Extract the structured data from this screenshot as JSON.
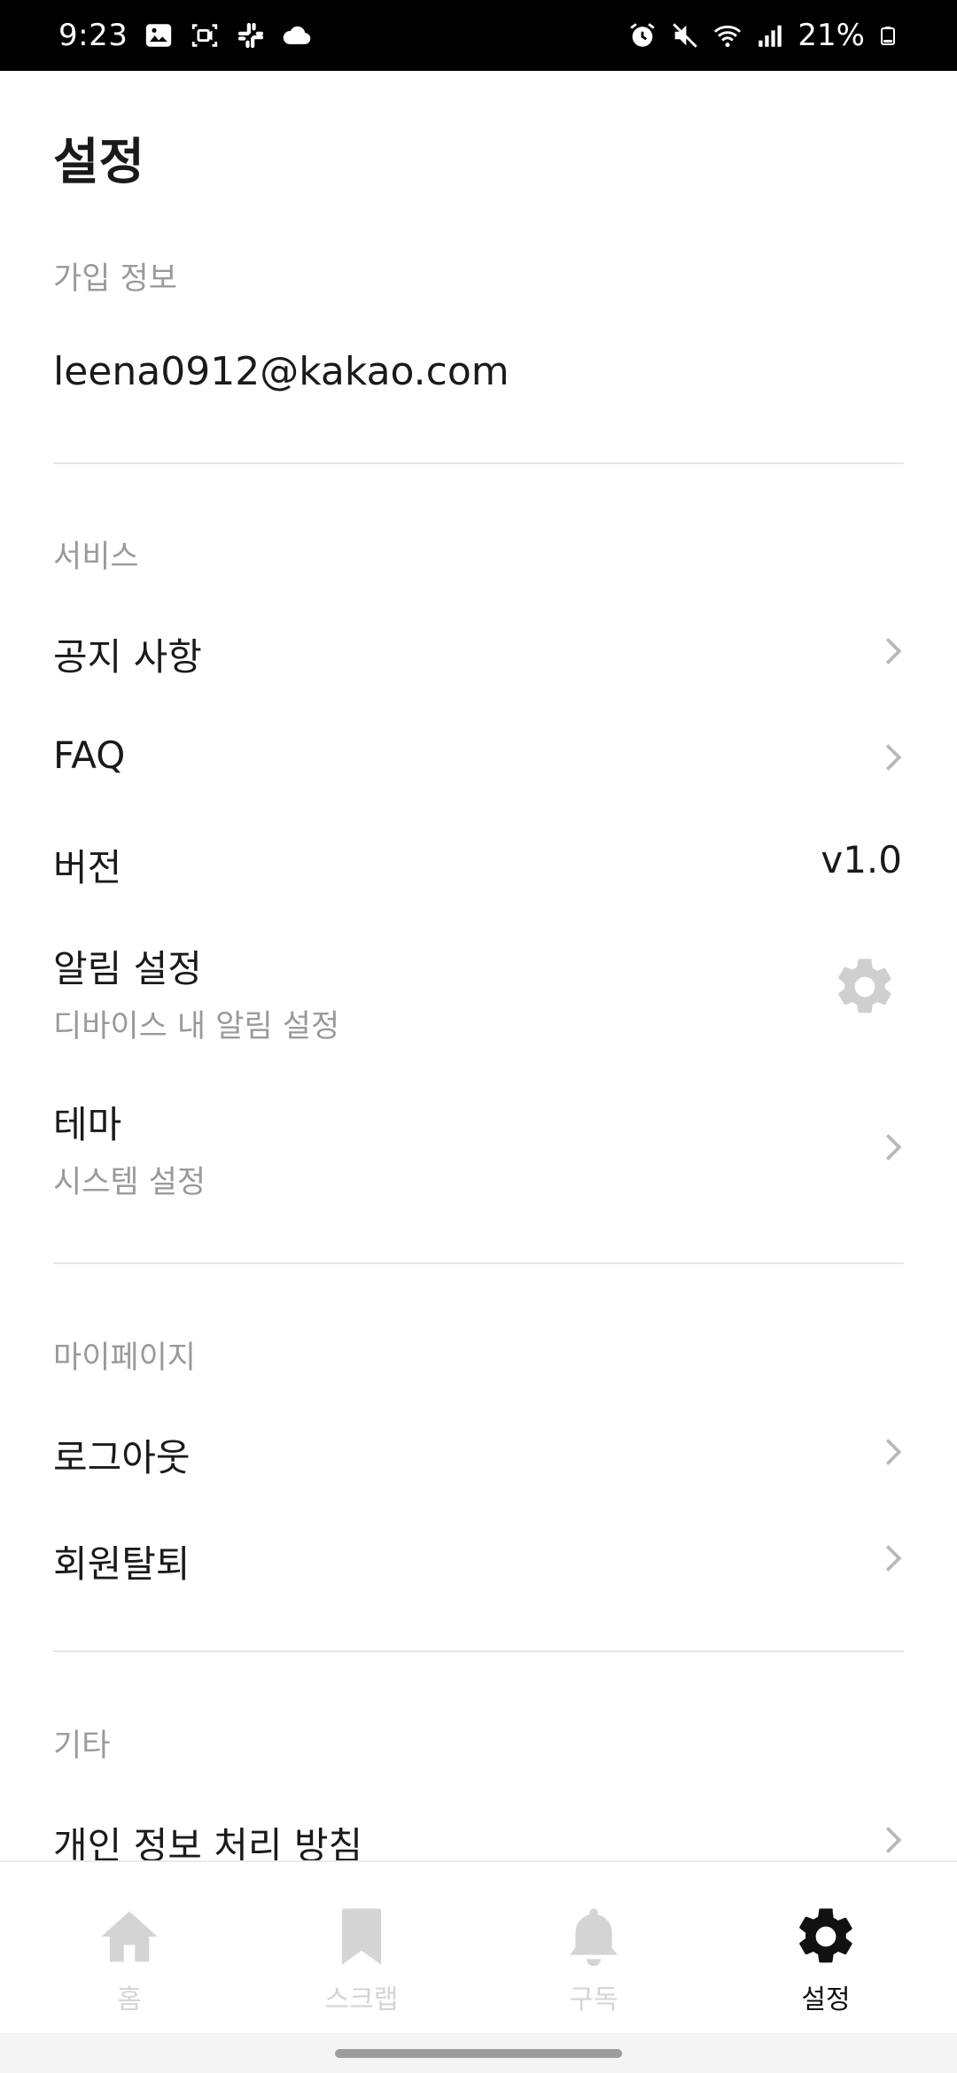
{
  "status_bar": {
    "time": "9:23",
    "battery": "21%",
    "left_icons": [
      "gallery-icon",
      "screen-record-icon",
      "slack-icon",
      "cloud-icon"
    ],
    "right_icons": [
      "alarm-icon",
      "mute-icon",
      "wifi-icon",
      "signal-icon",
      "battery-icon"
    ]
  },
  "page": {
    "title": "설정"
  },
  "account": {
    "header": "가입 정보",
    "email": "leena0912@kakao.com"
  },
  "service": {
    "header": "서비스",
    "notice": "공지 사항",
    "faq": "FAQ",
    "version_label": "버전",
    "version_value": "v1.0",
    "notification_label": "알림 설정",
    "notification_sub": "디바이스 내 알림 설정",
    "theme_label": "테마",
    "theme_sub": "시스템 설정"
  },
  "mypage": {
    "header": "마이페이지",
    "logout": "로그아웃",
    "withdraw": "회원탈퇴"
  },
  "etc": {
    "header": "기타",
    "privacy": "개인 정보 처리 방침"
  },
  "bottom_nav": {
    "items": [
      {
        "label": "홈",
        "icon": "home-icon",
        "active": false
      },
      {
        "label": "스크랩",
        "icon": "bookmark-icon",
        "active": false
      },
      {
        "label": "구독",
        "icon": "bell-icon",
        "active": false
      },
      {
        "label": "설정",
        "icon": "gear-icon",
        "active": true
      }
    ]
  },
  "colors": {
    "text_primary": "#1a1a1a",
    "text_secondary": "#9a9a9a",
    "nav_inactive": "#d4d4d4",
    "nav_active": "#111111",
    "gear_icon": "#cfcfcf"
  }
}
